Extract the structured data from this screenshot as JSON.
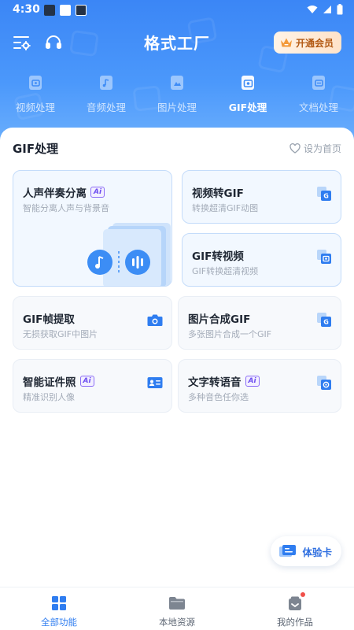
{
  "status_bar": {
    "time": "4:30"
  },
  "header": {
    "title": "格式工厂",
    "vip_label": "开通会员"
  },
  "tabs": [
    {
      "label": "视频处理",
      "icon": "video-process-icon"
    },
    {
      "label": "音频处理",
      "icon": "audio-process-icon"
    },
    {
      "label": "图片处理",
      "icon": "image-process-icon"
    },
    {
      "label": "GIF处理",
      "icon": "gif-process-icon",
      "active": true
    },
    {
      "label": "文档处理",
      "icon": "document-process-icon"
    }
  ],
  "section": {
    "title": "GIF处理",
    "set_home_label": "设为首页"
  },
  "ai_badge": "Ai",
  "cards": [
    {
      "title": "人声伴奏分离",
      "subtitle": "智能分离人声与背景音",
      "ai": true,
      "icon": "voice-separation-illustration"
    },
    {
      "title": "视频转GIF",
      "subtitle": "转换超清GIF动图",
      "icon": "video-to-gif-icon"
    },
    {
      "title": "GIF转视频",
      "subtitle": "GIF转换超清视频",
      "icon": "gif-to-video-icon"
    },
    {
      "title": "GIF帧提取",
      "subtitle": "无损获取GIF中图片",
      "icon": "camera-icon"
    },
    {
      "title": "图片合成GIF",
      "subtitle": "多张图片合成一个GIF",
      "icon": "images-to-gif-icon"
    },
    {
      "title": "智能证件照",
      "subtitle": "精准识别人像",
      "ai": true,
      "icon": "id-card-icon"
    },
    {
      "title": "文字转语音",
      "subtitle": "多种音色任你选",
      "ai": true,
      "icon": "text-to-speech-icon"
    }
  ],
  "trial_label": "体验卡",
  "bottom_nav": [
    {
      "label": "全部功能",
      "icon": "grid-icon",
      "active": true
    },
    {
      "label": "本地资源",
      "icon": "folder-icon"
    },
    {
      "label": "我的作品",
      "icon": "works-icon",
      "badge_dot": true
    }
  ],
  "colors": {
    "brand_blue": "#3b86f6",
    "active_nav": "#2f7df0",
    "vip_text": "#b35a14",
    "ai_purple": "#6d4ef0"
  }
}
